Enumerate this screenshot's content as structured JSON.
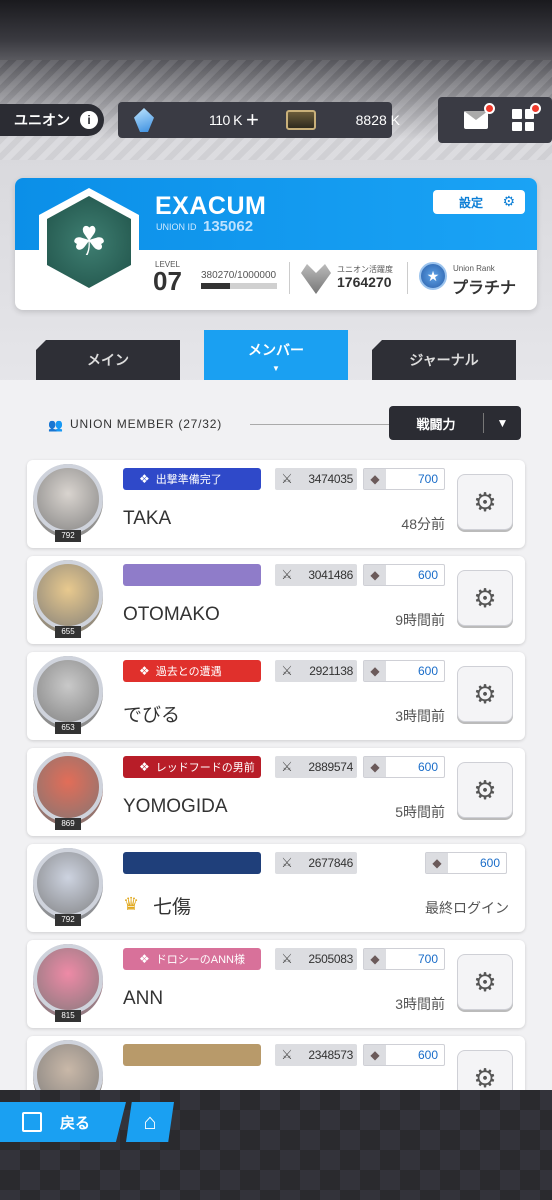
{
  "header": {
    "union_pill": "ユニオン",
    "info_glyph": "i",
    "gems": "110 K",
    "gems_plus": "+",
    "tickets": "8828 K"
  },
  "union": {
    "name": "EXACUM",
    "id_label": "UNION ID",
    "id": "135062",
    "settings": "設定",
    "level_label": "LEVEL",
    "level": "07",
    "xp_text": "380270/1000000",
    "xp_progress": 0.38027,
    "activity_label": "ユニオン活躍度",
    "activity": "1764270",
    "rank_label": "Union Rank",
    "rank": "プラチナ"
  },
  "tabs": {
    "main": "メイン",
    "members": "メンバー",
    "journal": "ジャーナル"
  },
  "member_list": {
    "title": "UNION MEMBER (27/32)",
    "sort_label": "戦闘力",
    "members": [
      {
        "name": "TAKA",
        "level": "792",
        "badge": "出撃準備完了",
        "badge_color": "#2f49c9",
        "power": "3474035",
        "contrib": "700",
        "time": "48分前"
      },
      {
        "name": "OTOMAKO",
        "level": "655",
        "badge": "",
        "badge_color": "#8f7cc9",
        "power": "3041486",
        "contrib": "600",
        "time": "9時間前"
      },
      {
        "name": "でびる",
        "level": "653",
        "badge": "過去との遭遇",
        "badge_color": "#e0302c",
        "power": "2921138",
        "contrib": "600",
        "time": "3時間前"
      },
      {
        "name": "YOMOGIDA",
        "level": "869",
        "badge": "レッドフードの男前",
        "badge_color": "#b81d28",
        "power": "2889574",
        "contrib": "600",
        "time": "5時間前"
      },
      {
        "name": "七傷",
        "level": "792",
        "badge": "",
        "badge_color": "#1f3f7a",
        "power": "2677846",
        "contrib": "600",
        "time": "最終ログイン"
      },
      {
        "name": "ANN",
        "level": "815",
        "badge": "ドロシーのANN様",
        "badge_color": "#d8719a",
        "power": "2505083",
        "contrib": "700",
        "time": "3時間前"
      },
      {
        "name": "",
        "level": "",
        "badge": "",
        "badge_color": "#b89a6a",
        "power": "2348573",
        "contrib": "600",
        "time": ""
      }
    ]
  },
  "bottom": {
    "back": "戻る"
  }
}
